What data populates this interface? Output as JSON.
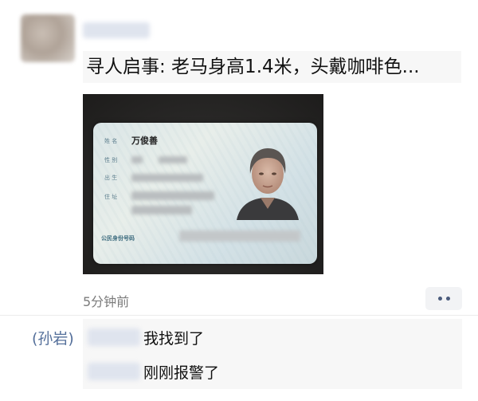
{
  "post": {
    "text": "寻人启事: 老马身高1.4米，头戴咖啡色...",
    "timestamp": "5分钟前"
  },
  "id_card": {
    "name_label": "姓 名",
    "gender_label": "性 别",
    "birth_label": "出 生",
    "address_label": "住 址",
    "name_value": "万俊善",
    "id_number_label": "公民身份号码"
  },
  "comments": {
    "side_tag": "(孙岩)",
    "items": [
      {
        "text": "我找到了"
      },
      {
        "text": "刚刚报警了"
      }
    ]
  },
  "icons": {
    "more": "more-dots-icon"
  },
  "colors": {
    "link_blue": "#55709b",
    "timestamp_gray": "#7b7b7b",
    "comment_bg": "#f7f7f7"
  }
}
